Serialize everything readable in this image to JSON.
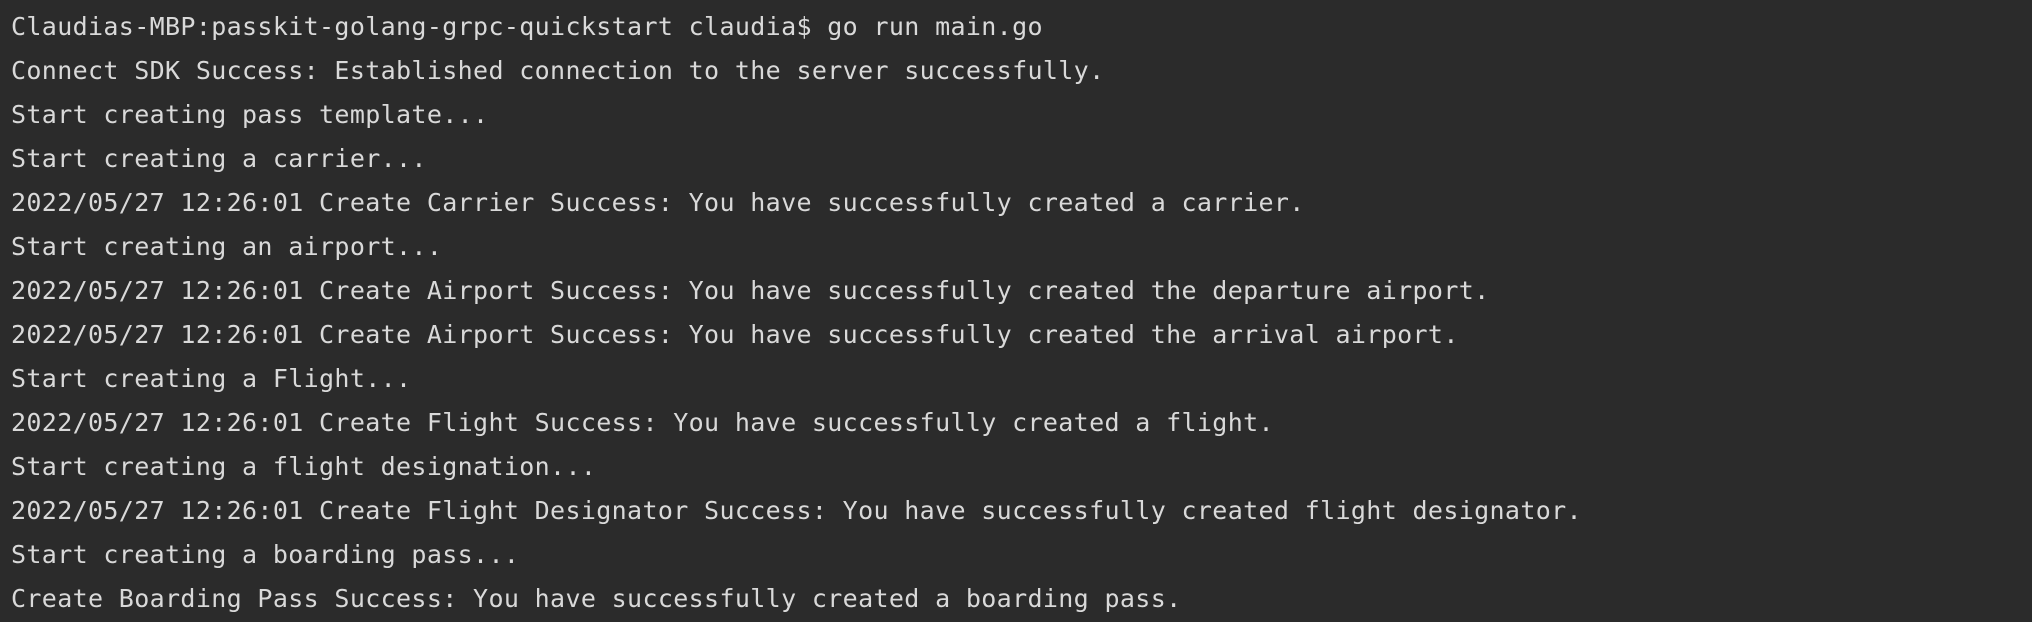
{
  "terminal": {
    "lines": [
      "Claudias-MBP:passkit-golang-grpc-quickstart claudia$ go run main.go",
      "Connect SDK Success: Established connection to the server successfully.",
      "Start creating pass template...",
      "Start creating a carrier...",
      "2022/05/27 12:26:01 Create Carrier Success: You have successfully created a carrier.",
      "Start creating an airport...",
      "2022/05/27 12:26:01 Create Airport Success: You have successfully created the departure airport.",
      "2022/05/27 12:26:01 Create Airport Success: You have successfully created the arrival airport.",
      "Start creating a Flight...",
      "2022/05/27 12:26:01 Create Flight Success: You have successfully created a flight.",
      "Start creating a flight designation...",
      "2022/05/27 12:26:01 Create Flight Designator Success: You have successfully created flight designator.",
      "Start creating a boarding pass...",
      "Create Boarding Pass Success: You have successfully created a boarding pass."
    ]
  },
  "colors": {
    "background": "#2b2b2b",
    "text": "#d9d9d9"
  }
}
